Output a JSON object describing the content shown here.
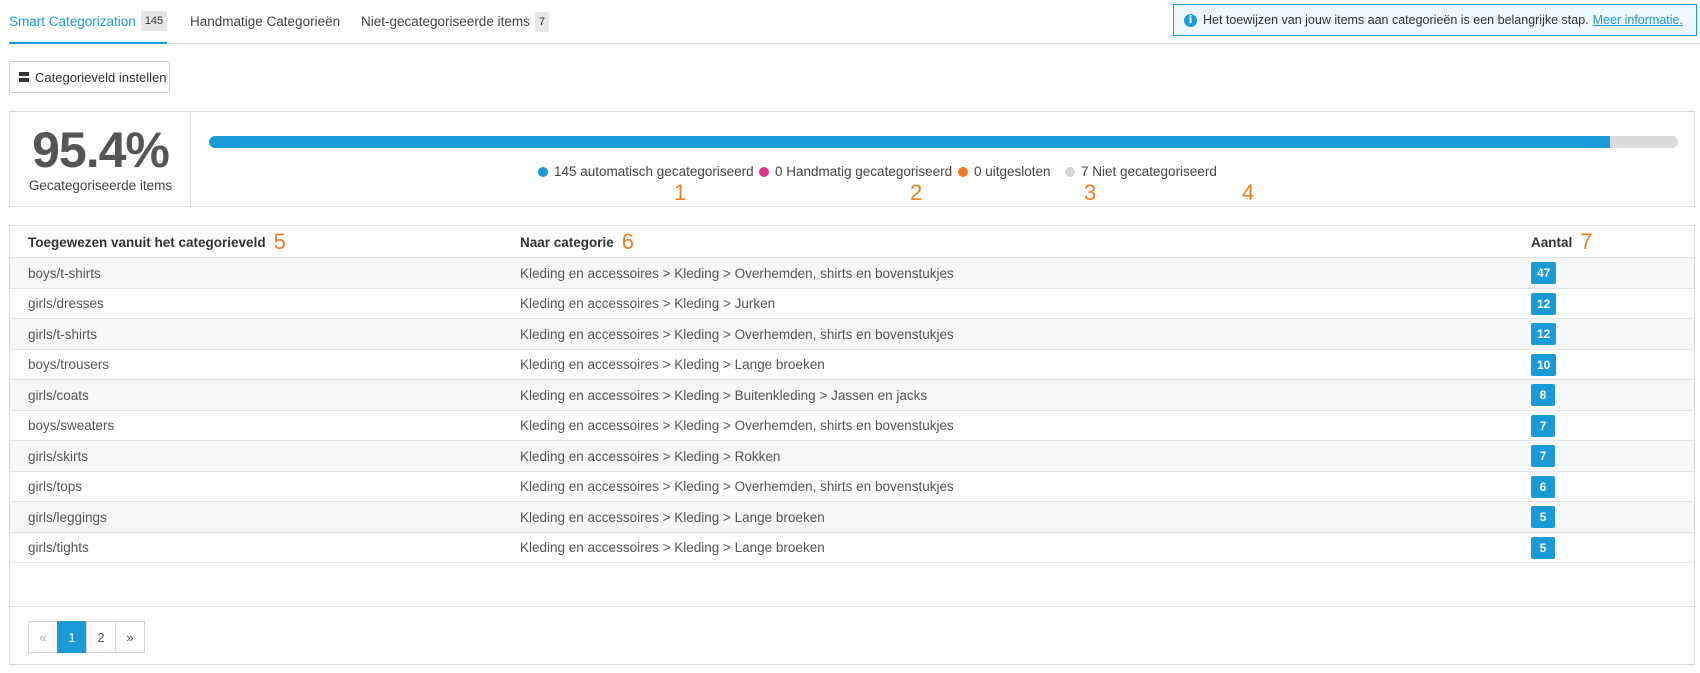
{
  "tabs": [
    {
      "label": "Smart Categorization",
      "count": "145"
    },
    {
      "label": "Handmatige Categorieën"
    },
    {
      "label": "Niet-gecategoriseerde items",
      "count": "7"
    }
  ],
  "info": {
    "text": "Het toewijzen van jouw items aan categorieën is een belangrijke stap.",
    "link": "Meer informatie.",
    "icon": "info-icon"
  },
  "toolbar": {
    "field_button": "Categorieveld instellen"
  },
  "summary": {
    "percent": "95.4%",
    "percent_label": "Gecategoriseerde items",
    "progress_fraction": 0.954,
    "legend": [
      {
        "label": "145 automatisch gecategoriseerd",
        "color": "#1a9ad6",
        "anno": "1"
      },
      {
        "label": "0 Handmatig gecategoriseerd",
        "color": "#e0358f",
        "anno": "2"
      },
      {
        "label": "0 uitgesloten",
        "color": "#ee7d1f",
        "anno": "3"
      },
      {
        "label": "7 Niet gecategoriseerd",
        "color": "#d6d6d6",
        "anno": "4"
      }
    ]
  },
  "table": {
    "headers": [
      {
        "label": "Toegewezen vanuit het categorieveld",
        "anno": "5"
      },
      {
        "label": "Naar categorie",
        "anno": "6"
      },
      {
        "label": "Aantal",
        "anno": "7"
      }
    ],
    "rows": [
      {
        "field": "boys/t-shirts",
        "category": "Kleding en accessoires > Kleding > Overhemden, shirts en bovenstukjes",
        "count": "47"
      },
      {
        "field": "girls/dresses",
        "category": "Kleding en accessoires > Kleding > Jurken",
        "count": "12"
      },
      {
        "field": "girls/t-shirts",
        "category": "Kleding en accessoires > Kleding > Overhemden, shirts en bovenstukjes",
        "count": "12"
      },
      {
        "field": "boys/trousers",
        "category": "Kleding en accessoires > Kleding > Lange broeken",
        "count": "10"
      },
      {
        "field": "girls/coats",
        "category": "Kleding en accessoires > Kleding > Buitenkleding > Jassen en jacks",
        "count": "8"
      },
      {
        "field": "boys/sweaters",
        "category": "Kleding en accessoires > Kleding > Overhemden, shirts en bovenstukjes",
        "count": "7"
      },
      {
        "field": "girls/skirts",
        "category": "Kleding en accessoires > Kleding > Rokken",
        "count": "7"
      },
      {
        "field": "girls/tops",
        "category": "Kleding en accessoires > Kleding > Overhemden, shirts en bovenstukjes",
        "count": "6"
      },
      {
        "field": "girls/leggings",
        "category": "Kleding en accessoires > Kleding > Lange broeken",
        "count": "5"
      },
      {
        "field": "girls/tights",
        "category": "Kleding en accessoires > Kleding > Lange broeken",
        "count": "5"
      }
    ]
  },
  "pagination": {
    "prev": "«",
    "pages": [
      "1",
      "2"
    ],
    "current": "1",
    "next": "»"
  }
}
